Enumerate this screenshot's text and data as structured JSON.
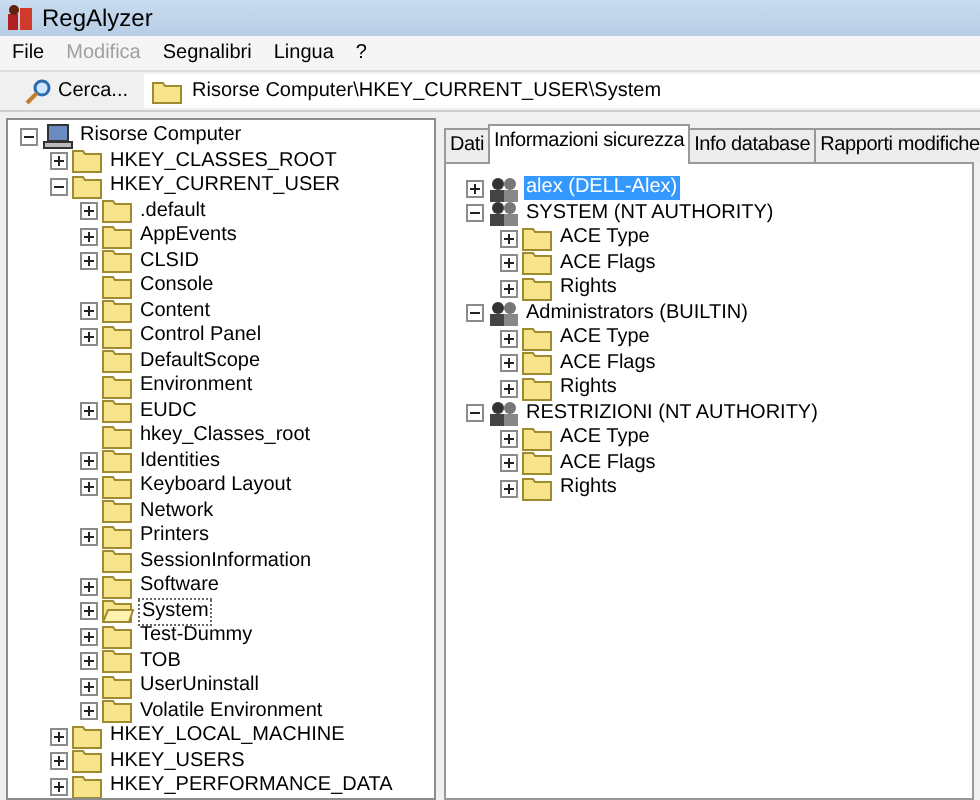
{
  "window": {
    "title": "RegAlyzer"
  },
  "menu": [
    {
      "label": "File",
      "disabled": false
    },
    {
      "label": "Modifica",
      "disabled": true
    },
    {
      "label": "Segnalibri",
      "disabled": false
    },
    {
      "label": "Lingua",
      "disabled": false
    },
    {
      "label": "?",
      "disabled": false
    }
  ],
  "toolbar": {
    "search_button": "Cerca...",
    "path": "Risorse Computer\\HKEY_CURRENT_USER\\System"
  },
  "tree": [
    {
      "label": "Risorse Computer",
      "kind": "computer",
      "expanded": true,
      "selected": false,
      "children": [
        {
          "label": "HKEY_CLASSES_ROOT",
          "kind": "folder",
          "expanded": false,
          "selected": false
        },
        {
          "label": "HKEY_CURRENT_USER",
          "kind": "folder",
          "expanded": true,
          "selected": false,
          "children": [
            {
              "label": ".default",
              "kind": "folder",
              "expanded": false,
              "selected": false
            },
            {
              "label": "AppEvents",
              "kind": "folder",
              "expanded": false,
              "selected": false
            },
            {
              "label": "CLSID",
              "kind": "folder",
              "expanded": false,
              "selected": false
            },
            {
              "label": "Console",
              "kind": "folder",
              "selected": false
            },
            {
              "label": "Content",
              "kind": "folder",
              "expanded": false,
              "selected": false
            },
            {
              "label": "Control Panel",
              "kind": "folder",
              "expanded": false,
              "selected": false
            },
            {
              "label": "DefaultScope",
              "kind": "folder",
              "selected": false
            },
            {
              "label": "Environment",
              "kind": "folder",
              "selected": false
            },
            {
              "label": "EUDC",
              "kind": "folder",
              "expanded": false,
              "selected": false
            },
            {
              "label": "hkey_Classes_root",
              "kind": "folder",
              "selected": false
            },
            {
              "label": "Identities",
              "kind": "folder",
              "expanded": false,
              "selected": false
            },
            {
              "label": "Keyboard Layout",
              "kind": "folder",
              "expanded": false,
              "selected": false
            },
            {
              "label": "Network",
              "kind": "folder",
              "selected": false
            },
            {
              "label": "Printers",
              "kind": "folder",
              "expanded": false,
              "selected": false
            },
            {
              "label": "SessionInformation",
              "kind": "folder",
              "selected": false
            },
            {
              "label": "Software",
              "kind": "folder",
              "expanded": false,
              "selected": false
            },
            {
              "label": "System",
              "kind": "folder",
              "expanded": false,
              "selected": true
            },
            {
              "label": "Test-Dummy",
              "kind": "folder",
              "expanded": false,
              "selected": false
            },
            {
              "label": "TOB",
              "kind": "folder",
              "expanded": false,
              "selected": false
            },
            {
              "label": "UserUninstall",
              "kind": "folder",
              "expanded": false,
              "selected": false
            },
            {
              "label": "Volatile Environment",
              "kind": "folder",
              "expanded": false,
              "selected": false
            }
          ]
        },
        {
          "label": "HKEY_LOCAL_MACHINE",
          "kind": "folder",
          "expanded": false,
          "selected": false
        },
        {
          "label": "HKEY_USERS",
          "kind": "folder",
          "expanded": false,
          "selected": false
        },
        {
          "label": "HKEY_PERFORMANCE_DATA",
          "kind": "folder",
          "expanded": false,
          "selected": false
        }
      ]
    }
  ],
  "tabs": [
    {
      "label": "Dati",
      "selected": false
    },
    {
      "label": "Informazioni sicurezza",
      "selected": true
    },
    {
      "label": "Info database",
      "selected": false
    },
    {
      "label": "Rapporti modifiche",
      "selected": false
    }
  ],
  "security_tree": [
    {
      "label": "alex (DELL-Alex)",
      "kind": "user",
      "expanded": false,
      "selected": true
    },
    {
      "label": "SYSTEM (NT AUTHORITY)",
      "kind": "user",
      "expanded": true,
      "selected": false,
      "children": [
        {
          "label": "ACE Type",
          "kind": "folder",
          "expanded": false,
          "selected": false
        },
        {
          "label": "ACE Flags",
          "kind": "folder",
          "expanded": false,
          "selected": false
        },
        {
          "label": "Rights",
          "kind": "folder",
          "expanded": false,
          "selected": false
        }
      ]
    },
    {
      "label": "Administrators (BUILTIN)",
      "kind": "user",
      "expanded": true,
      "selected": false,
      "children": [
        {
          "label": "ACE Type",
          "kind": "folder",
          "expanded": false,
          "selected": false
        },
        {
          "label": "ACE Flags",
          "kind": "folder",
          "expanded": false,
          "selected": false
        },
        {
          "label": "Rights",
          "kind": "folder",
          "expanded": false,
          "selected": false
        }
      ]
    },
    {
      "label": "RESTRIZIONI (NT AUTHORITY)",
      "kind": "user",
      "expanded": true,
      "selected": false,
      "children": [
        {
          "label": "ACE Type",
          "kind": "folder",
          "expanded": false,
          "selected": false
        },
        {
          "label": "ACE Flags",
          "kind": "folder",
          "expanded": false,
          "selected": false
        },
        {
          "label": "Rights",
          "kind": "folder",
          "expanded": false,
          "selected": false
        }
      ]
    }
  ]
}
